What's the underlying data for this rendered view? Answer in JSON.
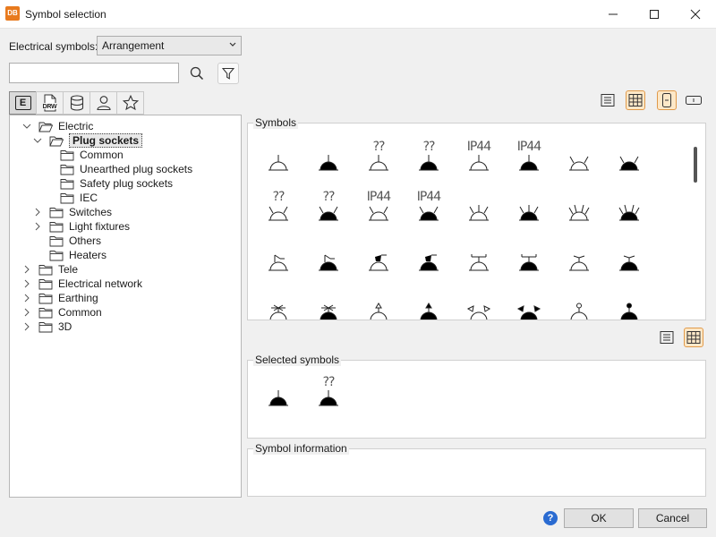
{
  "window": {
    "app_icon": "DB",
    "title": "Symbol selection",
    "controls": [
      "minimize-icon",
      "maximize-icon",
      "close-icon"
    ]
  },
  "filter": {
    "label": "Electrical symbols:",
    "selected": "Arrangement",
    "search_value": "",
    "search_placeholder": ""
  },
  "tabs": [
    {
      "icon": "electric-e-icon",
      "label": "E",
      "active": true
    },
    {
      "icon": "drw-file-icon",
      "label": "DRW",
      "active": false
    },
    {
      "icon": "database-icon",
      "label": "",
      "active": false
    },
    {
      "icon": "user-icon",
      "label": "",
      "active": false
    },
    {
      "icon": "star-icon",
      "label": "",
      "active": false
    }
  ],
  "tree": [
    {
      "label": "Electric",
      "level": 0,
      "expanded": true,
      "has_children": true,
      "selected": false
    },
    {
      "label": "Plug sockets",
      "level": 1,
      "expanded": true,
      "has_children": true,
      "selected": true
    },
    {
      "label": "Common",
      "level": 2,
      "expanded": false,
      "has_children": false,
      "selected": false
    },
    {
      "label": "Unearthed plug sockets",
      "level": 2,
      "expanded": false,
      "has_children": false,
      "selected": false
    },
    {
      "label": "Safety plug sockets",
      "level": 2,
      "expanded": false,
      "has_children": false,
      "selected": false
    },
    {
      "label": "IEC",
      "level": 2,
      "expanded": false,
      "has_children": false,
      "selected": false
    },
    {
      "label": "Switches",
      "level": 1,
      "expanded": false,
      "has_children": true,
      "selected": false
    },
    {
      "label": "Light fixtures",
      "level": 1,
      "expanded": false,
      "has_children": true,
      "selected": false
    },
    {
      "label": "Others",
      "level": 1,
      "expanded": false,
      "has_children": false,
      "selected": false
    },
    {
      "label": "Heaters",
      "level": 1,
      "expanded": false,
      "has_children": false,
      "selected": false
    },
    {
      "label": "Tele",
      "level": 0,
      "expanded": false,
      "has_children": true,
      "selected": false
    },
    {
      "label": "Electrical network",
      "level": 0,
      "expanded": false,
      "has_children": true,
      "selected": false
    },
    {
      "label": "Earthing",
      "level": 0,
      "expanded": false,
      "has_children": true,
      "selected": false
    },
    {
      "label": "Common",
      "level": 0,
      "expanded": false,
      "has_children": true,
      "selected": false
    },
    {
      "label": "3D",
      "level": 0,
      "expanded": false,
      "has_children": true,
      "selected": false
    }
  ],
  "symbols_panel": {
    "title": "Symbols",
    "view_buttons": [
      {
        "icon": "list-view-icon",
        "active": false
      },
      {
        "icon": "grid-view-icon",
        "active": true
      },
      {
        "icon": "vertical-layout-icon",
        "active": true
      },
      {
        "icon": "horizontal-layout-icon",
        "active": false
      }
    ],
    "rows": [
      [
        {
          "label": "",
          "filled": false,
          "variant": "single"
        },
        {
          "label": "",
          "filled": true,
          "variant": "single"
        },
        {
          "label": "??",
          "filled": false,
          "variant": "single"
        },
        {
          "label": "??",
          "filled": true,
          "variant": "single"
        },
        {
          "label": "IP44",
          "filled": false,
          "variant": "single"
        },
        {
          "label": "IP44",
          "filled": true,
          "variant": "single"
        },
        {
          "label": "",
          "filled": false,
          "variant": "double"
        },
        {
          "label": "",
          "filled": true,
          "variant": "double"
        }
      ],
      [
        {
          "label": "??",
          "filled": false,
          "variant": "double"
        },
        {
          "label": "??",
          "filled": true,
          "variant": "double"
        },
        {
          "label": "IP44",
          "filled": false,
          "variant": "double"
        },
        {
          "label": "IP44",
          "filled": true,
          "variant": "double"
        },
        {
          "label": "",
          "filled": false,
          "variant": "triple"
        },
        {
          "label": "",
          "filled": true,
          "variant": "triple"
        },
        {
          "label": "",
          "filled": false,
          "variant": "quad"
        },
        {
          "label": "",
          "filled": true,
          "variant": "quad"
        }
      ],
      [
        {
          "label": "",
          "filled": false,
          "variant": "switched"
        },
        {
          "label": "",
          "filled": true,
          "variant": "switched"
        },
        {
          "label": "",
          "filled": false,
          "variant": "switched-box"
        },
        {
          "label": "",
          "filled": true,
          "variant": "switched-box"
        },
        {
          "label": "",
          "filled": false,
          "variant": "tbar"
        },
        {
          "label": "",
          "filled": true,
          "variant": "tbar"
        },
        {
          "label": "",
          "filled": false,
          "variant": "tbar-small"
        },
        {
          "label": "",
          "filled": true,
          "variant": "tbar-small"
        }
      ],
      [
        {
          "label": "",
          "filled": false,
          "variant": "cross"
        },
        {
          "label": "",
          "filled": true,
          "variant": "cross"
        },
        {
          "label": "",
          "filled": false,
          "variant": "arrow"
        },
        {
          "label": "",
          "filled": true,
          "variant": "arrow"
        },
        {
          "label": "",
          "filled": false,
          "variant": "angles"
        },
        {
          "label": "",
          "filled": true,
          "variant": "angles"
        },
        {
          "label": "",
          "filled": false,
          "variant": "circle"
        },
        {
          "label": "",
          "filled": true,
          "variant": "circle"
        }
      ]
    ]
  },
  "selected_view_buttons": [
    {
      "icon": "list-view-icon",
      "active": false
    },
    {
      "icon": "grid-view-icon",
      "active": true
    }
  ],
  "selected_panel": {
    "title": "Selected symbols",
    "items": [
      {
        "label": "",
        "filled": true,
        "variant": "single"
      },
      {
        "label": "??",
        "filled": true,
        "variant": "single"
      }
    ]
  },
  "info_panel": {
    "title": "Symbol information"
  },
  "footer": {
    "help_icon": "help-icon",
    "ok_label": "OK",
    "cancel_label": "Cancel"
  },
  "colors": {
    "accent_orange": "#e87a1e",
    "active_view_bg": "#fde8c8",
    "active_view_border": "#e09a4a",
    "help_blue": "#2a6bd1"
  }
}
